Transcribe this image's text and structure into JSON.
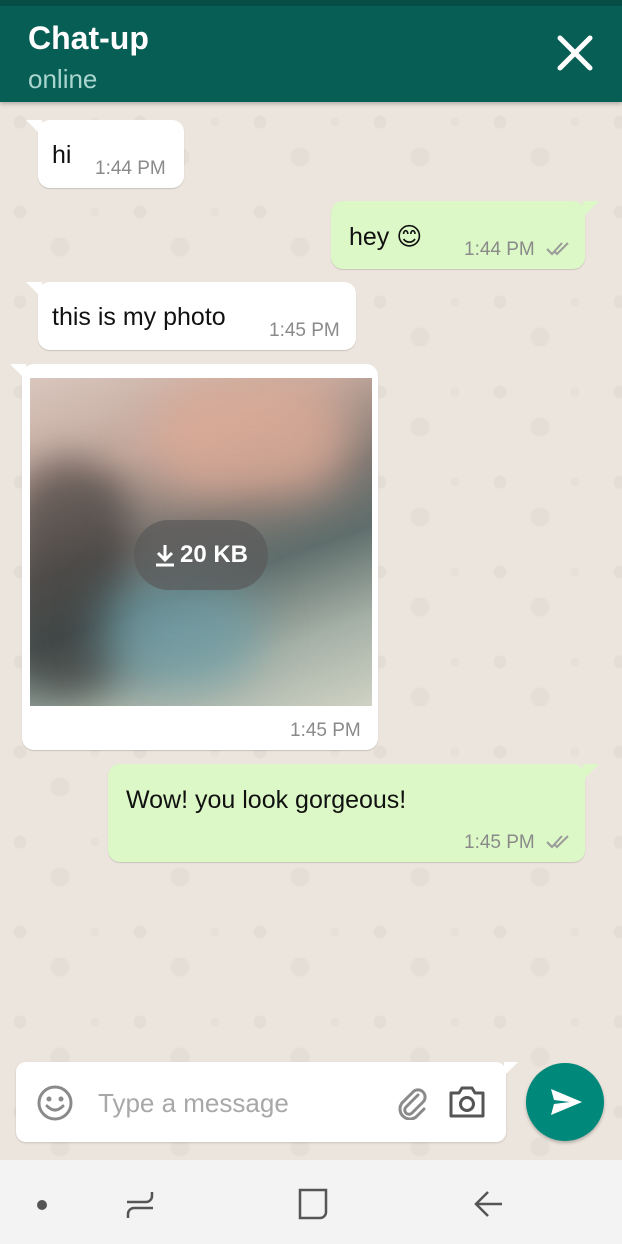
{
  "header": {
    "title": "Chat-up",
    "status": "online"
  },
  "messages": [
    {
      "direction": "in",
      "text": "hi",
      "time": "1:44 PM"
    },
    {
      "direction": "out",
      "text": "hey 😊",
      "time": "1:44 PM",
      "read": true
    },
    {
      "direction": "in",
      "text": "this is my photo",
      "time": "1:45 PM"
    },
    {
      "direction": "in",
      "type": "photo",
      "download_label": "20 KB",
      "time": "1:45 PM"
    },
    {
      "direction": "out",
      "text": "Wow! you look gorgeous!",
      "time": "1:45 PM",
      "read": true
    }
  ],
  "composer": {
    "placeholder": "Type a message"
  },
  "icons": {
    "header": [
      "close-icon"
    ],
    "composer": [
      "emoji-icon",
      "attach-icon",
      "camera-icon",
      "send-icon"
    ],
    "navbar": [
      "dot-icon",
      "recent-apps-icon",
      "home-icon",
      "back-icon"
    ]
  },
  "colors": {
    "header": "#075e54",
    "outgoing_bubble": "#dcf8c6",
    "send_button": "#00897b",
    "chat_bg": "#ece5dd"
  }
}
